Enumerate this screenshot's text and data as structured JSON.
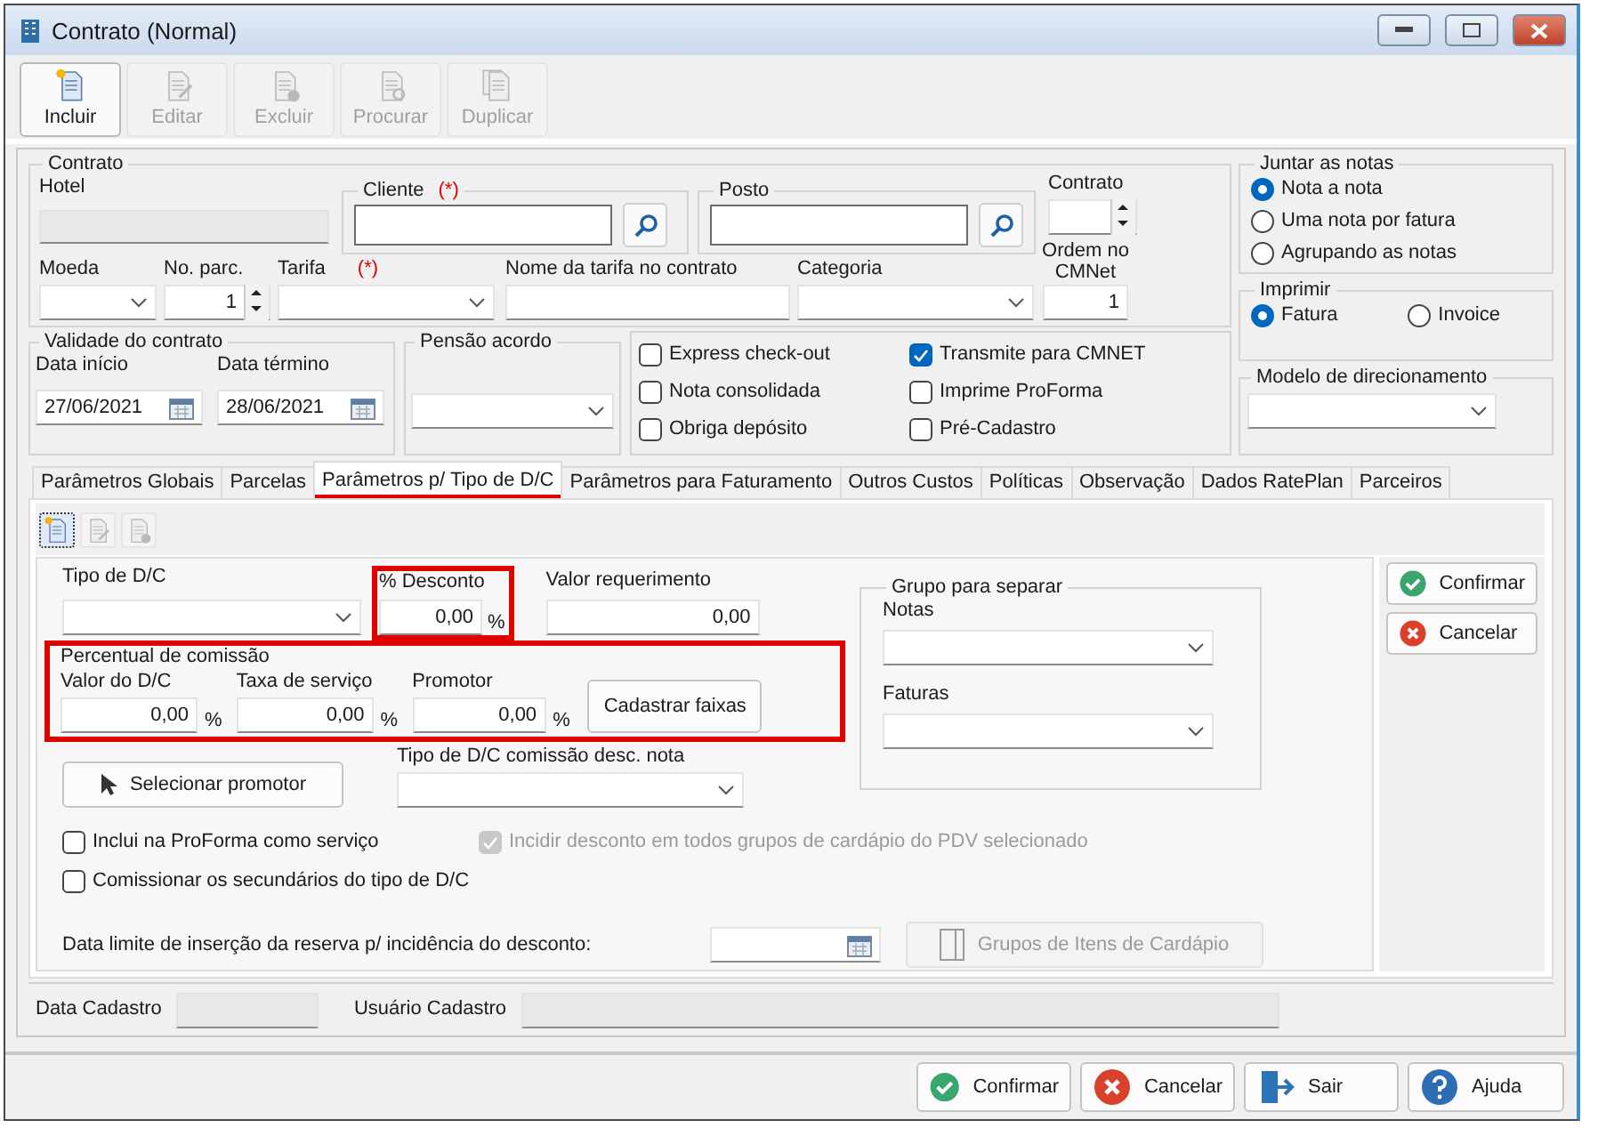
{
  "window": {
    "title": "Contrato (Normal)"
  },
  "toolbar": [
    {
      "label": "Incluir",
      "kind": "new",
      "disabled": false
    },
    {
      "label": "Editar",
      "kind": "edit",
      "disabled": true
    },
    {
      "label": "Excluir",
      "kind": "delete",
      "disabled": true
    },
    {
      "label": "Procurar",
      "kind": "search",
      "disabled": true
    },
    {
      "label": "Duplicar",
      "kind": "copy",
      "disabled": true
    }
  ],
  "contrato": {
    "legend": "Contrato",
    "hotel": "Hotel",
    "cliente": {
      "label": "Cliente",
      "required": "(*)"
    },
    "posto": {
      "label": "Posto"
    },
    "contrato": "Contrato",
    "moeda": "Moeda",
    "parcelas": {
      "label": "No. parc.",
      "value": "1"
    },
    "tarifa": {
      "label": "Tarifa",
      "required": "(*)"
    },
    "nome_tarifa": "Nome da tarifa no contrato",
    "categoria": "Categoria",
    "ordem": {
      "label": "Ordem no CMNet",
      "value": "1"
    }
  },
  "validade": {
    "legend": "Validade do contrato",
    "inicio": {
      "label": "Data início",
      "value": "27/06/2021"
    },
    "termino": {
      "label": "Data término",
      "value": "28/06/2021"
    }
  },
  "pensao": {
    "legend": "Pensão acordo"
  },
  "options": [
    {
      "label": "Express check-out",
      "checked": false
    },
    {
      "label": "Nota consolidada",
      "checked": false
    },
    {
      "label": "Obriga depósito",
      "checked": false
    },
    {
      "label": "Transmite para CMNET",
      "checked": true
    },
    {
      "label": "Imprime ProForma",
      "checked": false
    },
    {
      "label": "Pré-Cadastro",
      "checked": false
    }
  ],
  "juntar": {
    "legend": "Juntar as notas",
    "options": [
      {
        "label": "Nota a nota",
        "selected": true
      },
      {
        "label": "Uma nota por fatura",
        "selected": false
      },
      {
        "label": "Agrupando as notas",
        "selected": false
      }
    ]
  },
  "imprimir": {
    "legend": "Imprimir",
    "options": [
      {
        "label": "Fatura",
        "selected": true
      },
      {
        "label": "Invoice",
        "selected": false
      }
    ]
  },
  "modelo": {
    "legend": "Modelo de direcionamento"
  },
  "tabs": [
    {
      "label": "Parâmetros Globais",
      "selected": false,
      "underlined": false
    },
    {
      "label": "Parcelas",
      "selected": false,
      "underlined": false
    },
    {
      "label": "Parâmetros p/ Tipo de D/C",
      "selected": true,
      "underlined": true
    },
    {
      "label": "Parâmetros para Faturamento",
      "selected": false,
      "underlined": false
    },
    {
      "label": "Outros Custos",
      "selected": false,
      "underlined": false
    },
    {
      "label": "Políticas",
      "selected": false,
      "underlined": false
    },
    {
      "label": "Observação",
      "selected": false,
      "underlined": false
    },
    {
      "label": "Dados RatePlan",
      "selected": false,
      "underlined": false
    },
    {
      "label": "Parceiros",
      "selected": false,
      "underlined": false
    }
  ],
  "dc": {
    "tipo": "Tipo de D/C",
    "desconto": {
      "label": "% Desconto",
      "value": "0,00",
      "unit": "%",
      "highlighted": true
    },
    "valor_requerimento": {
      "label": "Valor requerimento",
      "value": "0,00"
    },
    "comissao": {
      "legend": "Percentual de comissão",
      "highlighted": true,
      "fields": [
        {
          "label": "Valor do D/C",
          "value": "0,00",
          "unit": "%"
        },
        {
          "label": "Taxa de serviço",
          "value": "0,00",
          "unit": "%"
        },
        {
          "label": "Promotor",
          "value": "0,00",
          "unit": "%"
        }
      ],
      "button": "Cadastrar faixas"
    },
    "selecionar": "Selecionar promotor",
    "tipo_comissao": "Tipo de D/C comissão desc. nota",
    "grupo": {
      "legend": "Grupo para separar",
      "notas": "Notas",
      "faturas": "Faturas"
    },
    "checks": [
      {
        "label": "Inclui na ProForma como serviço",
        "checked": false,
        "disabled": false
      },
      {
        "label": "Incidir desconto em todos grupos de cardápio do PDV selecionado",
        "checked": true,
        "disabled": true
      },
      {
        "label": "Comissionar os secundários do tipo de D/C",
        "checked": false,
        "disabled": false
      }
    ],
    "data_limite": "Data limite de inserção da reserva p/ incidência do desconto:",
    "grupos_button": {
      "label": "Grupos de Itens de Cardápio",
      "disabled": true
    },
    "side_buttons": [
      {
        "label": "Confirmar",
        "kind": "confirm"
      },
      {
        "label": "Cancelar",
        "kind": "cancel"
      }
    ]
  },
  "footer": {
    "data_cadastro": "Data Cadastro",
    "usuario_cadastro": "Usuário Cadastro"
  },
  "buttons": [
    {
      "label": "Confirmar",
      "kind": "confirm"
    },
    {
      "label": "Cancelar",
      "kind": "cancel"
    },
    {
      "label": "Sair",
      "kind": "exit"
    },
    {
      "label": "Ajuda",
      "kind": "help"
    }
  ]
}
